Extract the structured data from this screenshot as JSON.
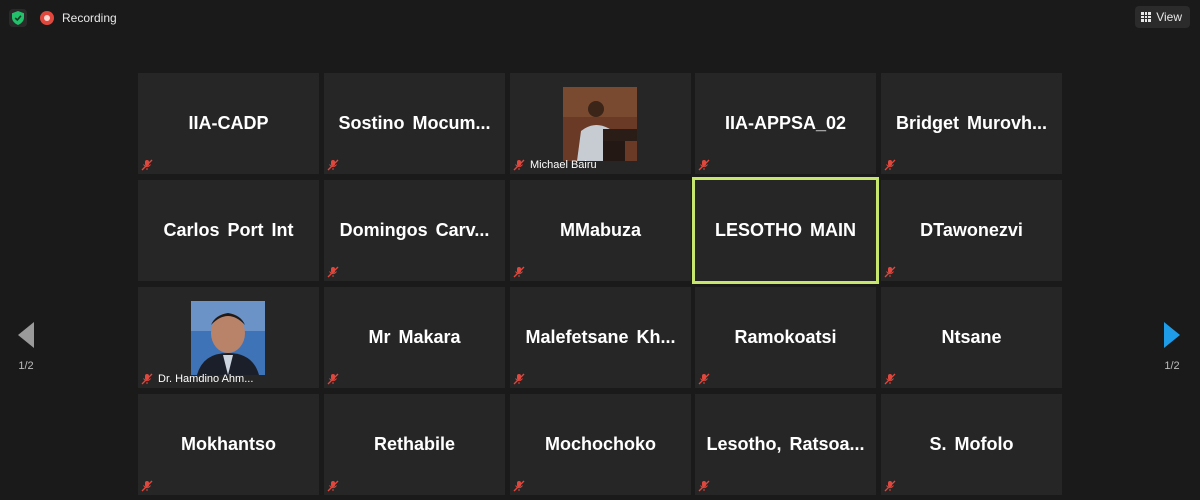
{
  "topbar": {
    "recording_label": "Recording",
    "view_label": "View"
  },
  "pagination": {
    "prev_page": "1/2",
    "next_page": "1/2"
  },
  "colors": {
    "background": "#1a1a1a",
    "tile": "#262626",
    "active_speaker_border": "#c7e66e",
    "muted_icon": "#e0483e",
    "next_arrow": "#1f9ce8"
  },
  "participants": [
    {
      "display_name": "IIA-CADP",
      "has_video": false,
      "muted": true
    },
    {
      "display_name": "Sostino  Mocum...",
      "has_video": false,
      "muted": true
    },
    {
      "display_name": "Michael Bairu",
      "has_video": true,
      "muted": true
    },
    {
      "display_name": "IIA-APPSA_02",
      "has_video": false,
      "muted": true
    },
    {
      "display_name": "Bridget  Murovh...",
      "has_video": false,
      "muted": true
    },
    {
      "display_name": "Carlos Port Int",
      "has_video": false,
      "muted": false
    },
    {
      "display_name": "Domingos  Carv...",
      "has_video": false,
      "muted": true
    },
    {
      "display_name": "MMabuza",
      "has_video": false,
      "muted": true
    },
    {
      "display_name": "LESOTHO MAIN",
      "has_video": false,
      "muted": false,
      "active_speaker": true
    },
    {
      "display_name": "DTawonezvi",
      "has_video": false,
      "muted": true
    },
    {
      "display_name": "Dr. Hamdino Ahm...",
      "has_video": true,
      "muted": true
    },
    {
      "display_name": "Mr Makara",
      "has_video": false,
      "muted": true
    },
    {
      "display_name": "Malefetsane  Kh...",
      "has_video": false,
      "muted": true
    },
    {
      "display_name": "Ramokoatsi",
      "has_video": false,
      "muted": true
    },
    {
      "display_name": "Ntsane",
      "has_video": false,
      "muted": true
    },
    {
      "display_name": "Mokhantso",
      "has_video": false,
      "muted": true
    },
    {
      "display_name": "Rethabile",
      "has_video": false,
      "muted": true
    },
    {
      "display_name": "Mochochoko",
      "has_video": false,
      "muted": true
    },
    {
      "display_name": "Lesotho,  Ratsoa...",
      "has_video": false,
      "muted": true
    },
    {
      "display_name": "S. Mofolo",
      "has_video": false,
      "muted": true
    }
  ]
}
